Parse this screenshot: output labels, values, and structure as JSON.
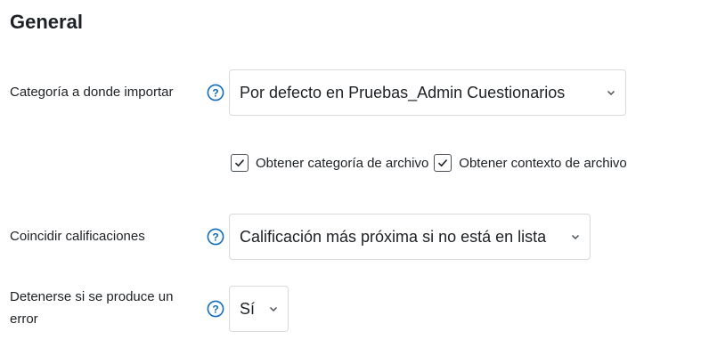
{
  "section": {
    "title": "General"
  },
  "fields": {
    "category": {
      "label": "Categoría a donde importar",
      "selected": "Por defecto en Pruebas_Admin Cuestionarios"
    },
    "checkboxes": [
      {
        "label": "Obtener categoría de archivo",
        "checked": true
      },
      {
        "label": "Obtener contexto de archivo",
        "checked": true
      }
    ],
    "grades": {
      "label": "Coincidir calificaciones",
      "selected": "Calificación más próxima si no está en lista"
    },
    "stop_on_error": {
      "label": "Detenerse si se produce un error",
      "selected": "Sí"
    }
  },
  "icons": {
    "help": "question-circle-icon",
    "dropdown": "chevron-down-icon",
    "check": "checkmark-icon"
  },
  "colors": {
    "help_icon": "#0f6cbf",
    "text": "#1d2125",
    "border": "#d7dadd"
  }
}
